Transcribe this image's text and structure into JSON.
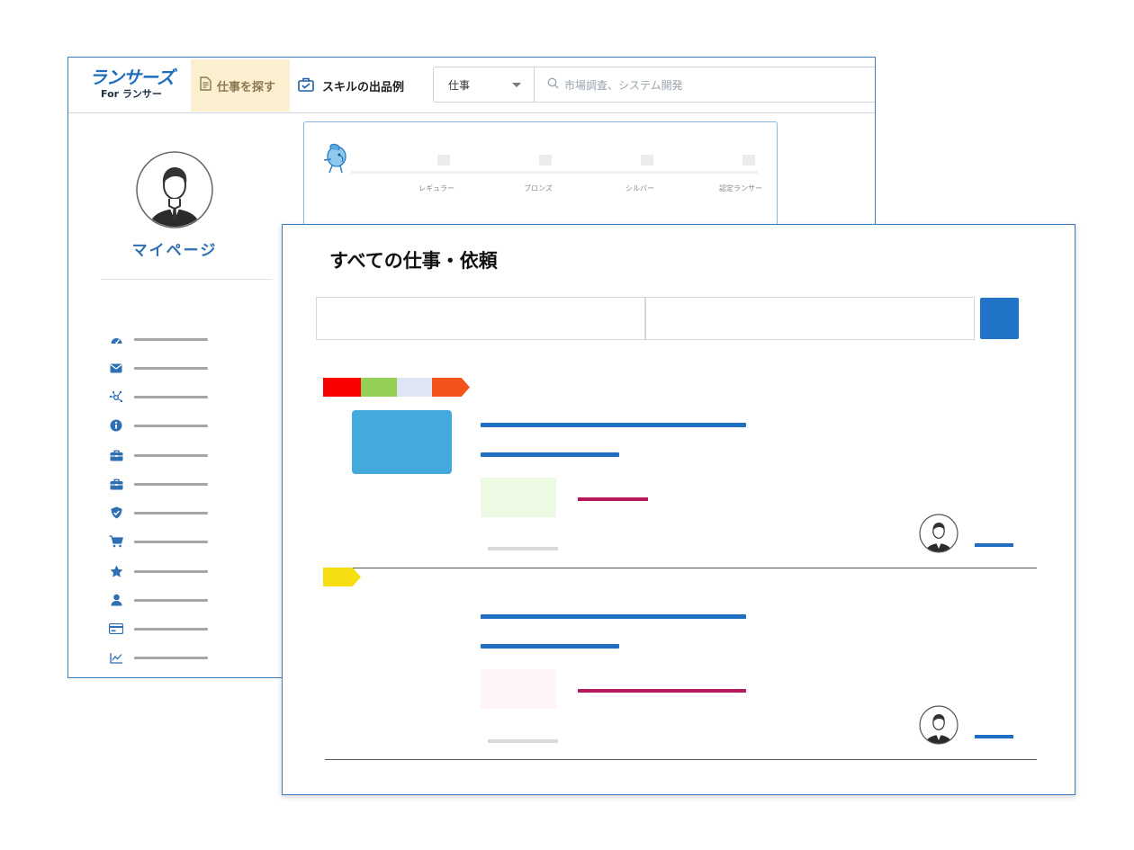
{
  "back_window": {
    "logo": {
      "main": "ランサーズ",
      "sub": "For ランサー"
    },
    "nav": {
      "find_jobs": "仕事を探す",
      "skills": "スキルの出品例"
    },
    "search": {
      "category": "仕事",
      "placeholder": "市場調査、システム開発"
    },
    "sidebar": {
      "title": "マイページ",
      "items": [
        {
          "icon": "dashboard-icon"
        },
        {
          "icon": "envelope-icon"
        },
        {
          "icon": "network-icon"
        },
        {
          "icon": "info-icon"
        },
        {
          "icon": "briefcase-icon"
        },
        {
          "icon": "briefcase-icon"
        },
        {
          "icon": "shield-check-icon"
        },
        {
          "icon": "cart-icon"
        },
        {
          "icon": "star-icon"
        },
        {
          "icon": "user-icon"
        },
        {
          "icon": "credit-card-icon"
        },
        {
          "icon": "chart-icon"
        }
      ]
    },
    "rank": {
      "levels": [
        "レギュラー",
        "ブロンズ",
        "シルバー",
        "認定ランサー"
      ]
    }
  },
  "front_window": {
    "title": "すべての仕事・依頼",
    "tag_colors_row1": [
      "#fb0000",
      "#93d053",
      "#dde6f2",
      "#f6531a"
    ],
    "tag_colors_row2": [
      "#f5df11"
    ],
    "price_box_colors": [
      "#ecfae4",
      "#fff4f6"
    ]
  },
  "colors": {
    "brand_blue": "#1f6fbf",
    "accent_blue": "#2274c9",
    "pink": "#b5195a",
    "nav_highlight": "#fbefcf"
  }
}
